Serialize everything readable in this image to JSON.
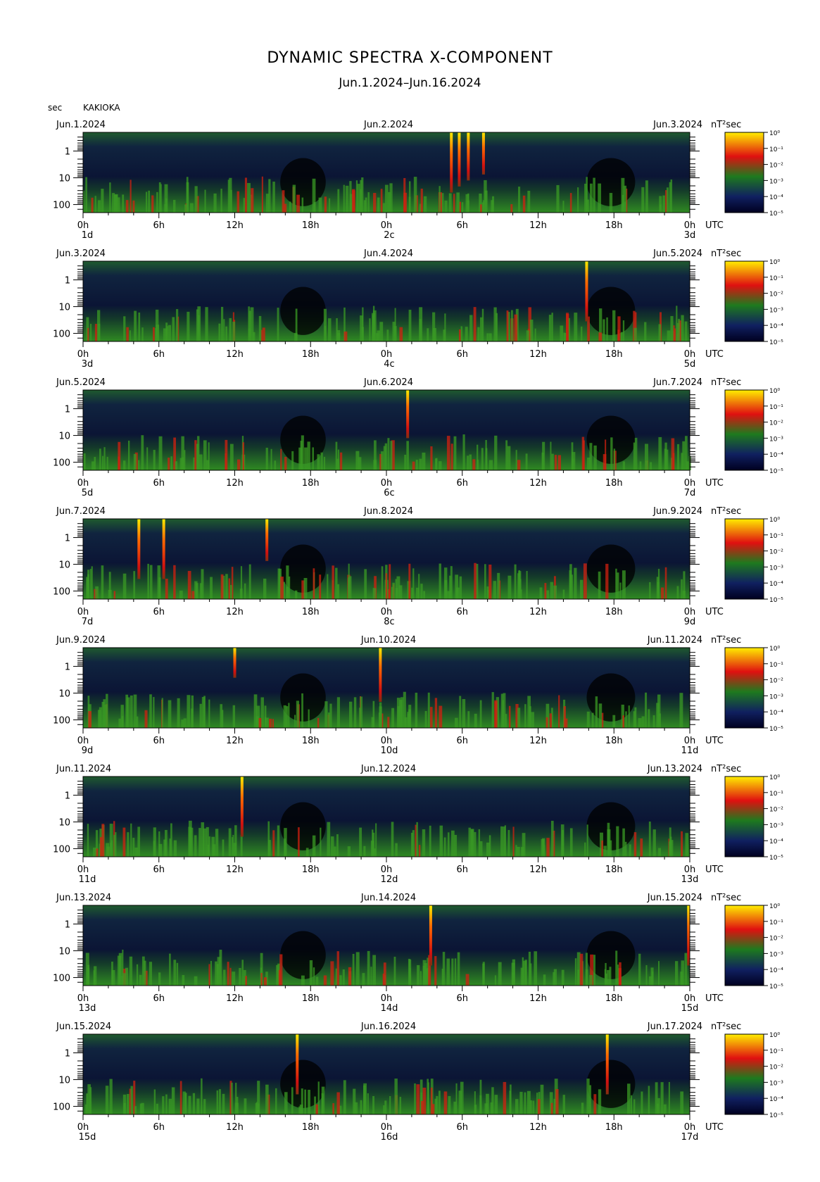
{
  "title": "DYNAMIC SPECTRA X-COMPONENT",
  "subtitle": "Jun.1.2024–Jun.16.2024",
  "period_label": "sec",
  "station": "KAKIOKA",
  "unit_label": "nT²sec",
  "time_ticks": [
    "0h",
    "6h",
    "12h",
    "18h",
    "0h",
    "6h",
    "12h",
    "18h",
    "0h"
  ],
  "utc_label": "UTC",
  "period_ticks": [
    "1",
    "10",
    "100"
  ],
  "colorbar_ticks": [
    "10⁰",
    "10⁻¹",
    "10⁻²",
    "10⁻³",
    "10⁻⁴",
    "10⁻⁵"
  ],
  "colors": {
    "background": "#0a0f2e",
    "low": "#000000",
    "mid": "#1e7a1e",
    "high": "#e01010",
    "peak": "#ffee00"
  },
  "panels": [
    {
      "date_left": "Jun.1.2024",
      "date_mid": "Jun.2.2024",
      "date_right": "Jun.3.2024",
      "day_left": "1d",
      "day_mid": "2c",
      "day_right": "3d",
      "spikes": [
        [
          0.607,
          1.0
        ],
        [
          0.62,
          0.9
        ],
        [
          0.635,
          0.8
        ],
        [
          0.66,
          0.7
        ]
      ]
    },
    {
      "date_left": "Jun.3.2024",
      "date_mid": "Jun.4.2024",
      "date_right": "Jun.5.2024",
      "day_left": "3d",
      "day_mid": "4c",
      "day_right": "5d",
      "spikes": [
        [
          0.83,
          1.0
        ]
      ]
    },
    {
      "date_left": "Jun.5.2024",
      "date_mid": "Jun.6.2024",
      "date_right": "Jun.7.2024",
      "day_left": "5d",
      "day_mid": "6c",
      "day_right": "7d",
      "spikes": [
        [
          0.535,
          0.8
        ]
      ]
    },
    {
      "date_left": "Jun.7.2024",
      "date_mid": "Jun.8.2024",
      "date_right": "Jun.9.2024",
      "day_left": "7d",
      "day_mid": "8c",
      "day_right": "9d",
      "spikes": [
        [
          0.092,
          1.0
        ],
        [
          0.133,
          1.0
        ],
        [
          0.303,
          0.7
        ]
      ]
    },
    {
      "date_left": "Jun.9.2024",
      "date_mid": "Jun.10.2024",
      "date_right": "Jun.11.2024",
      "day_left": "9d",
      "day_mid": "10d",
      "day_right": "11d",
      "spikes": [
        [
          0.25,
          0.5
        ],
        [
          0.49,
          0.9
        ]
      ]
    },
    {
      "date_left": "Jun.11.2024",
      "date_mid": "Jun.12.2024",
      "date_right": "Jun.13.2024",
      "day_left": "11d",
      "day_mid": "12d",
      "day_right": "13d",
      "spikes": [
        [
          0.262,
          1.0
        ]
      ]
    },
    {
      "date_left": "Jun.13.2024",
      "date_mid": "Jun.14.2024",
      "date_right": "Jun.15.2024",
      "day_left": "13d",
      "day_mid": "14d",
      "day_right": "15d",
      "spikes": [
        [
          0.573,
          1.0
        ],
        [
          0.998,
          1.0
        ]
      ]
    },
    {
      "date_left": "Jun.15.2024",
      "date_mid": "Jun.16.2024",
      "date_right": "Jun.17.2024",
      "day_left": "15d",
      "day_mid": "16d",
      "day_right": "17d",
      "spikes": [
        [
          0.353,
          1.0
        ],
        [
          0.864,
          1.0
        ]
      ]
    }
  ],
  "chart_data": {
    "type": "heatmap",
    "title": "DYNAMIC SPECTRA X-COMPONENT",
    "subtitle": "Jun.1.2024–Jun.16.2024",
    "ylabel": "sec",
    "colorbar_label": "nT²sec",
    "y_scale": "log",
    "y_ticks": [
      1,
      10,
      100
    ],
    "colorbar_ticks": [
      "10⁰",
      "10⁻¹",
      "10⁻²",
      "10⁻³",
      "10⁻⁴",
      "10⁻⁵"
    ],
    "x_ticks": [
      "0h",
      "6h",
      "12h",
      "18h",
      "0h",
      "6h",
      "12h",
      "18h",
      "0h"
    ],
    "x_unit": "UTC",
    "panels": 8,
    "grid": false
  }
}
